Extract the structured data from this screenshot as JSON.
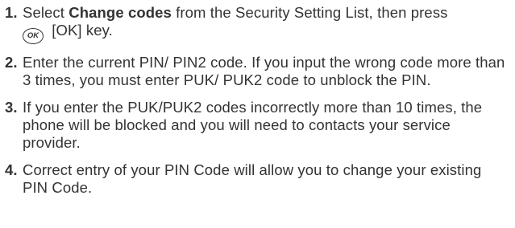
{
  "steps": [
    {
      "number": "1.",
      "text_before": "Select ",
      "bold": "Change codes",
      "text_middle": " from the Security Setting List, then press",
      "ok_icon_label": "OK",
      "text_after": " [OK] key."
    },
    {
      "number": "2.",
      "text": "Enter the current PIN/ PIN2 code. If you input the wrong code more than 3 times, you must enter PUK/ PUK2 code to unblock the PIN."
    },
    {
      "number": "3.",
      "text": "If you enter the PUK/PUK2 codes incorrectly more than 10 times, the phone will be blocked and you will need to contacts your service provider."
    },
    {
      "number": "4.",
      "text": "Correct entry of your PIN Code will allow you to change your existing PIN Code."
    }
  ]
}
